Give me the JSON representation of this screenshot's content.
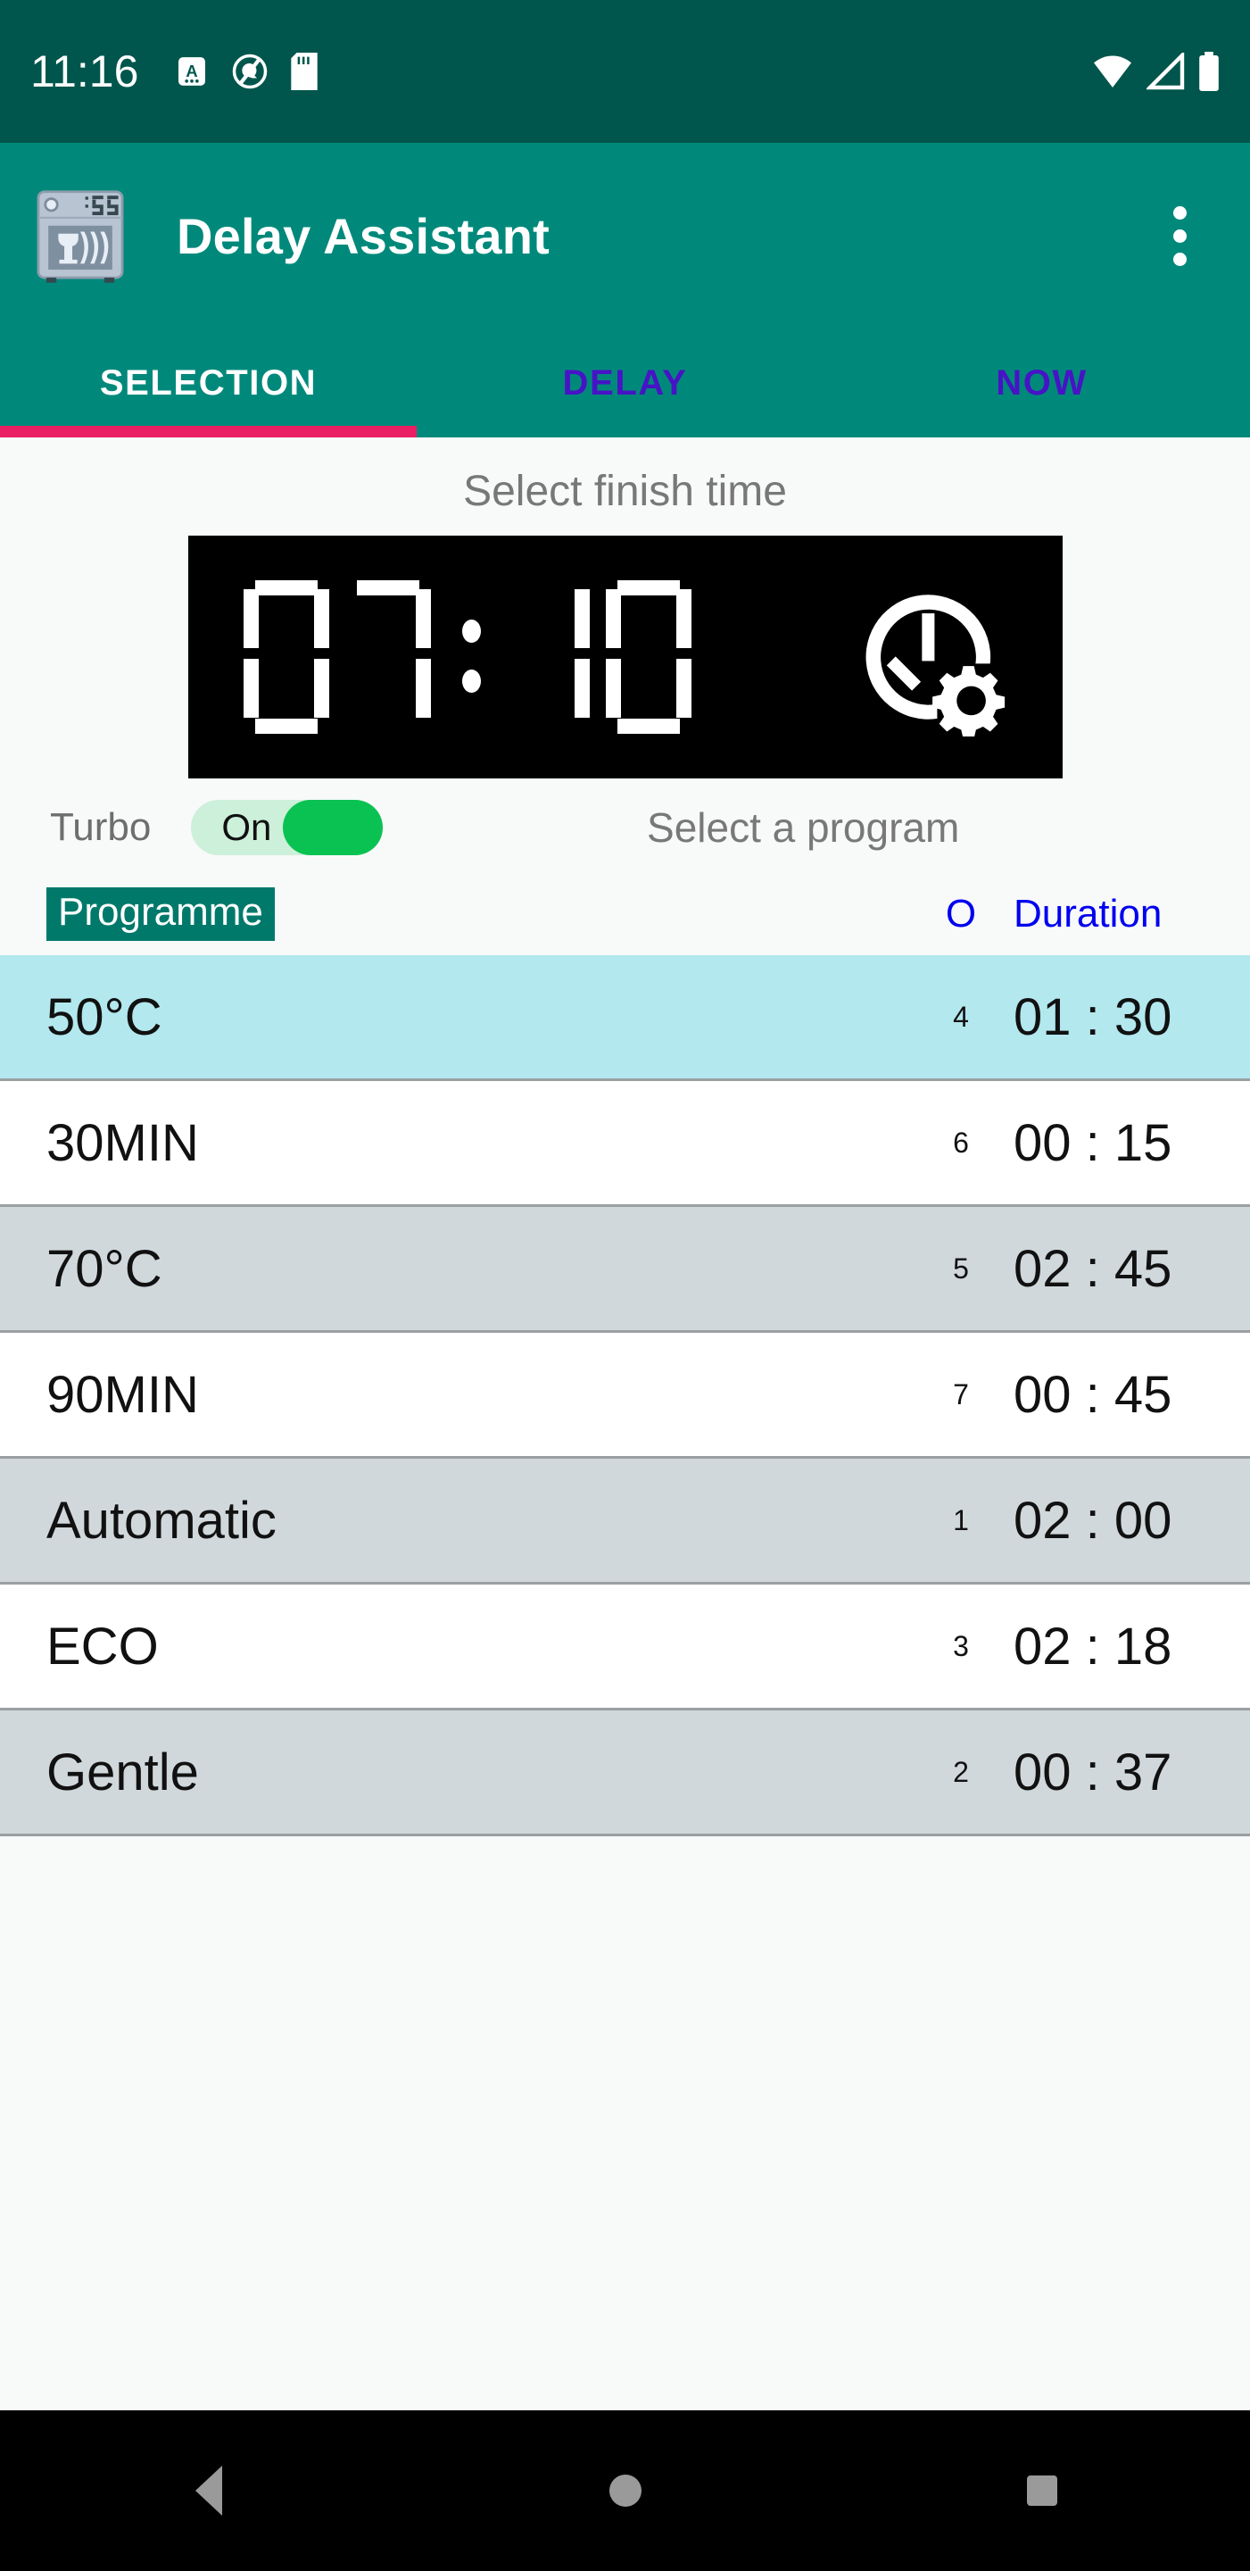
{
  "status_bar": {
    "time": "11:16",
    "left_icons": [
      "keyboard-input-a-icon",
      "quiet-mode-q-icon",
      "sd-card-icon"
    ],
    "right_icons": [
      "wifi-icon",
      "cellular-signal-icon",
      "battery-icon"
    ],
    "background": "#00564c"
  },
  "app_bar": {
    "title": "Delay Assistant",
    "app_icon": "dishwasher-icon",
    "app_icon_display": "1:55",
    "overflow_icon": "overflow-menu-icon",
    "background": "#00897b"
  },
  "tabs": {
    "items": [
      {
        "label": "SELECTION",
        "active": true
      },
      {
        "label": "DELAY",
        "active": false
      },
      {
        "label": "NOW",
        "active": false
      }
    ],
    "active_index": 0,
    "indicator_color": "#e91e63",
    "active_color": "#ffffff",
    "inactive_color": "#4713c6"
  },
  "main": {
    "section_title": "Select finish time",
    "lcd": {
      "hours": "07",
      "minutes": "10",
      "separator": ":",
      "display_text": "07:10",
      "icon": "clock-settings-icon",
      "background": "#000000",
      "foreground": "#ffffff"
    },
    "turbo": {
      "label": "Turbo",
      "state_text": "On",
      "enabled": true,
      "track_color": "#ccf0da",
      "thumb_color": "#0ac252"
    },
    "program_hint": "Select a program"
  },
  "table": {
    "headers": {
      "programme": "Programme",
      "order": "O",
      "duration": "Duration"
    },
    "sorted_by": "Programme",
    "header_active_bg": "#00796b",
    "header_link_color": "#0000f0",
    "selected_row_bg": "#b2e8ee",
    "alt_row_bg": "#d0d8dc",
    "rows": [
      {
        "name": "50°C",
        "order": "4",
        "duration": "01 : 30",
        "selected": true,
        "alt": false
      },
      {
        "name": "30MIN",
        "order": "6",
        "duration": "00 : 15",
        "selected": false,
        "alt": false
      },
      {
        "name": "70°C",
        "order": "5",
        "duration": "02 : 45",
        "selected": false,
        "alt": true
      },
      {
        "name": "90MIN",
        "order": "7",
        "duration": "00 : 45",
        "selected": false,
        "alt": false
      },
      {
        "name": "Automatic",
        "order": "1",
        "duration": "02 : 00",
        "selected": false,
        "alt": true
      },
      {
        "name": "ECO",
        "order": "3",
        "duration": "02 : 18",
        "selected": false,
        "alt": false
      },
      {
        "name": "Gentle",
        "order": "2",
        "duration": "00 : 37",
        "selected": false,
        "alt": true
      }
    ]
  },
  "nav_bar": {
    "back": "back-triangle-icon",
    "home": "home-circle-icon",
    "recents": "recents-square-icon",
    "background": "#000000"
  }
}
